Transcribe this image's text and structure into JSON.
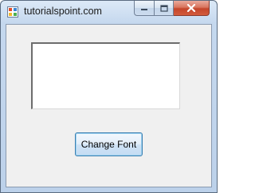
{
  "window": {
    "title": "tutorialspoint.com",
    "icon": "winforms-app-icon"
  },
  "title_controls": {
    "minimize_icon": "minimize-icon",
    "maximize_icon": "maximize-icon",
    "close_icon": "close-icon"
  },
  "form": {
    "textbox_value": "",
    "button_label": "Change Font"
  },
  "colors": {
    "close_button": "#c4452b",
    "client_background": "#f0f0f0",
    "button_border": "#3c7fb1"
  }
}
